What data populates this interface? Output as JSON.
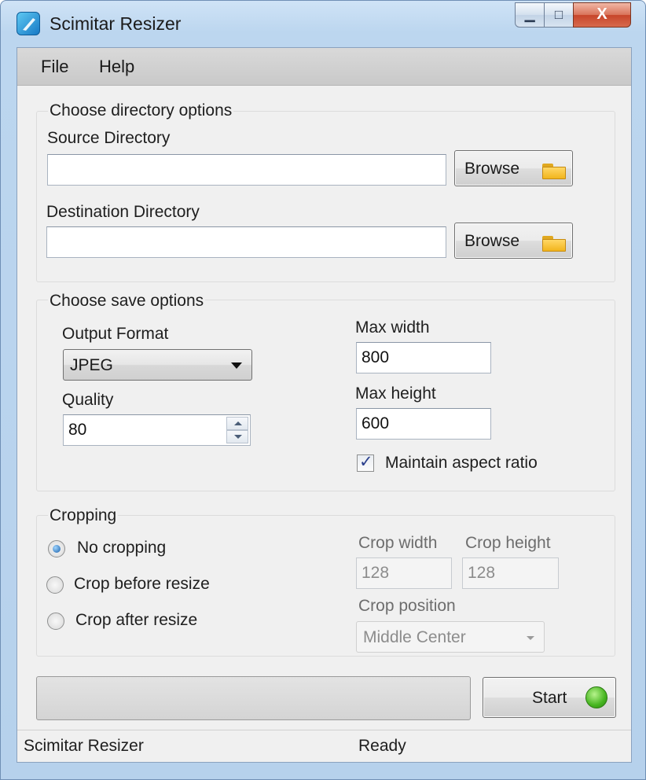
{
  "window": {
    "title": "Scimitar Resizer",
    "controls": {
      "minimize": "▁",
      "maximize": "□",
      "close": "X"
    }
  },
  "menu": {
    "items": [
      "File",
      "Help"
    ]
  },
  "directory": {
    "group_title": "Choose directory options",
    "source_label": "Source Directory",
    "source_value": "",
    "destination_label": "Destination Directory",
    "destination_value": "",
    "browse_label": "Browse",
    "icon": "folder-icon"
  },
  "save": {
    "group_title": "Choose save options",
    "format_label": "Output Format",
    "format_value": "JPEG",
    "quality_label": "Quality",
    "quality_value": "80",
    "max_width_label": "Max width",
    "max_width_value": "800",
    "max_height_label": "Max height",
    "max_height_value": "600",
    "aspect_label": "Maintain aspect ratio",
    "aspect_checked": true
  },
  "cropping": {
    "group_title": "Cropping",
    "options": [
      "No cropping",
      "Crop before resize",
      "Crop after resize"
    ],
    "selected": "No cropping",
    "crop_width_label": "Crop width",
    "crop_width_value": "128",
    "crop_height_label": "Crop height",
    "crop_height_value": "128",
    "crop_position_label": "Crop position",
    "crop_position_value": "Middle Center"
  },
  "actions": {
    "progress": 0,
    "start_label": "Start",
    "start_indicator_color": "#46b520"
  },
  "status": {
    "app_name": "Scimitar Resizer",
    "state": "Ready"
  }
}
